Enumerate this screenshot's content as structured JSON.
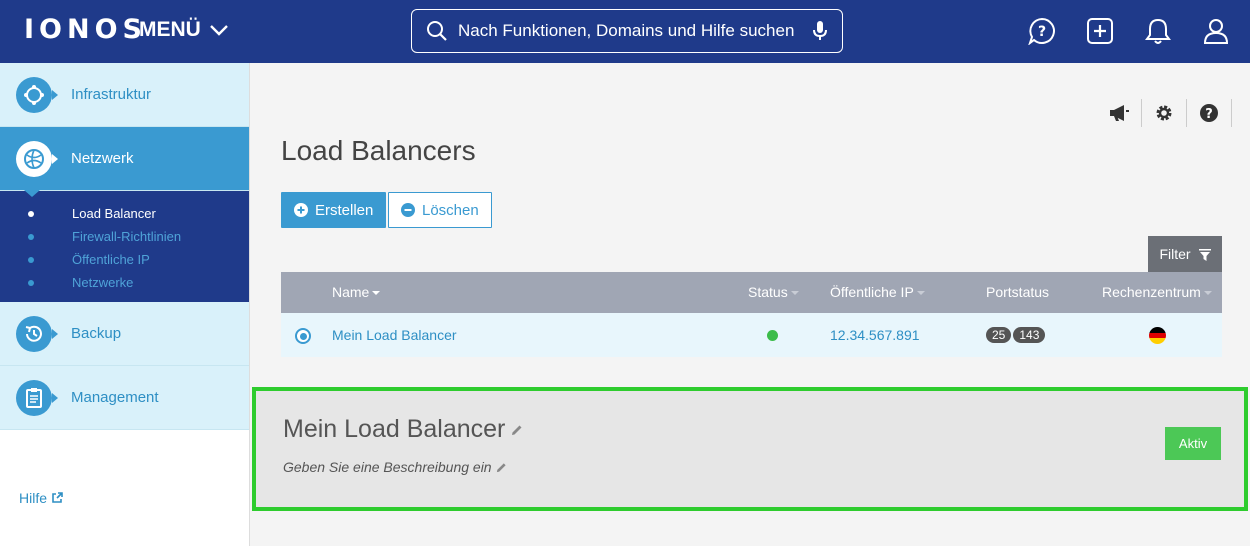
{
  "brand": {
    "logo": "IONOS",
    "primary": "#1f3a8a",
    "accent": "#3a9ad1",
    "success": "#4cc856"
  },
  "topbar": {
    "menu_label": "MENÜ",
    "search_placeholder": "Nach Funktionen, Domains und Hilfe suchen",
    "icons": [
      "help-chat-icon",
      "add-icon",
      "bell-icon",
      "user-icon"
    ]
  },
  "sidebar": {
    "items": [
      {
        "label": "Infrastruktur",
        "icon": "infrastructure-icon"
      },
      {
        "label": "Netzwerk",
        "icon": "network-icon",
        "active": true
      },
      {
        "label": "Backup",
        "icon": "backup-icon"
      },
      {
        "label": "Management",
        "icon": "clipboard-icon"
      }
    ],
    "subitems": [
      {
        "label": "Load Balancer",
        "active": true
      },
      {
        "label": "Firewall-Richtlinien"
      },
      {
        "label": "Öffentliche IP"
      },
      {
        "label": "Netzwerke"
      }
    ],
    "help_label": "Hilfe"
  },
  "main": {
    "util_icons": [
      "megaphone-icon",
      "settings-icon",
      "help-icon"
    ],
    "title": "Load Balancers",
    "create_label": "Erstellen",
    "delete_label": "Löschen",
    "filter_label": "Filter",
    "table": {
      "columns": [
        "Name",
        "Status",
        "Öffentliche IP",
        "Portstatus",
        "Rechenzentrum"
      ],
      "rows": [
        {
          "name": "Mein Load Balancer",
          "status": "online",
          "ip": "12.34.567.891",
          "ports": [
            "25",
            "143"
          ],
          "datacenter": "Germany"
        }
      ]
    },
    "detail": {
      "title": "Mein Load Balancer",
      "description_placeholder": "Geben Sie eine Beschreibung ein",
      "status_label": "Aktiv"
    }
  }
}
